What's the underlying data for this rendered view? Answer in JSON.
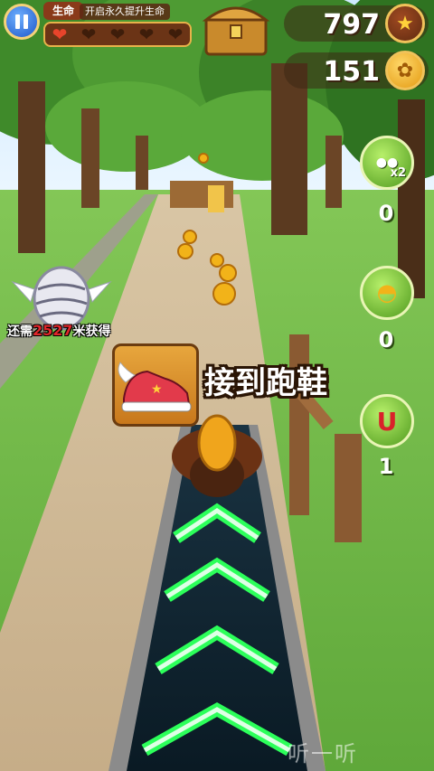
{
  "hud": {
    "life_label": "生命",
    "life_hint": "开启永久提升生命",
    "hearts_filled": 1,
    "hearts_total": 5,
    "score": "797",
    "coins": "151"
  },
  "powerups": [
    {
      "icon": "coin-double-icon",
      "badge": "x2",
      "count": "0"
    },
    {
      "icon": "helmet-icon",
      "count": "0"
    },
    {
      "icon": "magnet-icon",
      "count": "1"
    }
  ],
  "egg": {
    "prefix": "还需",
    "distance": "2527",
    "suffix": "米获得"
  },
  "notification": "接到跑鞋",
  "watermark": "听一听"
}
